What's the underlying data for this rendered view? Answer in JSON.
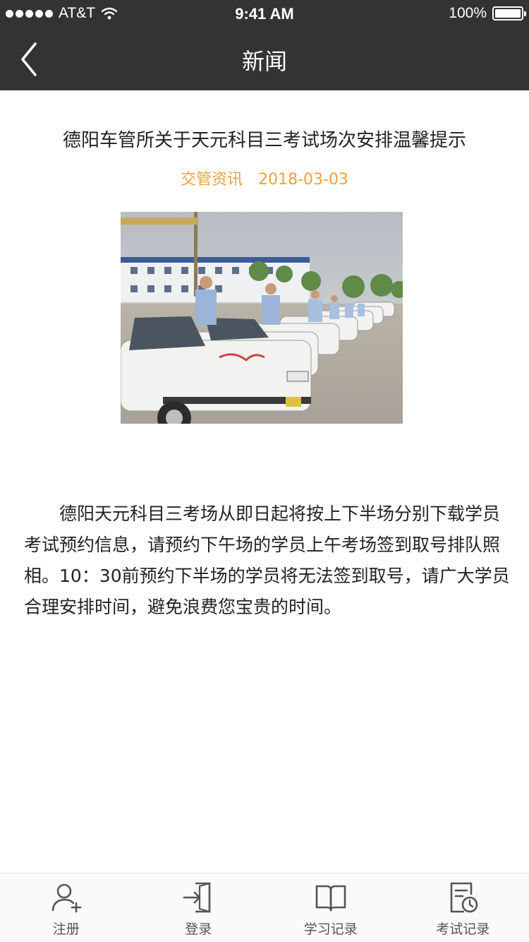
{
  "status_bar": {
    "carrier": "AT&T",
    "time": "9:41 AM",
    "battery": "100%"
  },
  "nav": {
    "title": "新闻"
  },
  "article": {
    "title": "德阳车管所关于天元科目三考试场次安排温馨提示",
    "category": "交管资讯",
    "date": "2018-03-03",
    "body": "德阳天元科目三考场从即日起将按上下半场分别下载学员考试预约信息，请预约下午场的学员上午考场签到取号排队照相。10：30前预约下半场的学员将无法签到取号，请广大学员合理安排时间，避免浪费您宝贵的时间。"
  },
  "tabbar": {
    "items": [
      {
        "label": "注册",
        "icon": "user-add-icon"
      },
      {
        "label": "登录",
        "icon": "login-icon"
      },
      {
        "label": "学习记录",
        "icon": "book-icon"
      },
      {
        "label": "考试记录",
        "icon": "exam-record-icon"
      }
    ]
  },
  "colors": {
    "navbar": "#333333",
    "accent": "#f0a040",
    "tab_icon": "#555555"
  }
}
